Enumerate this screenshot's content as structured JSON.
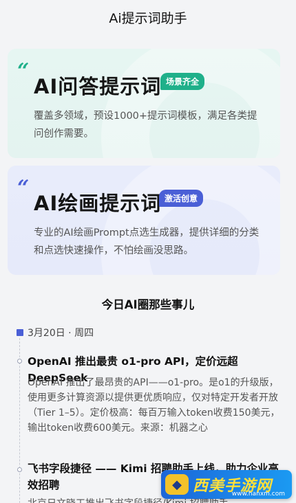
{
  "header": {
    "title": "Ai提示词助手"
  },
  "cards": {
    "qa": {
      "title": "AI问答提示词",
      "badge": "场景齐全",
      "description": "覆盖多领域，预设1000+提示词模板，满足各类提问创作需要。"
    },
    "draw": {
      "title": "AI绘画提示词",
      "badge": "激活创意",
      "description": "专业的AI绘画Prompt点选生成器，提供详细的分类和点选快速操作，不怕绘画没思路。"
    }
  },
  "news": {
    "section_title": "今日AI圈那些事儿",
    "date": "3月20日 · 周四",
    "items": [
      {
        "title": "OpenAI 推出最贵 o1-pro API，定价远超 DeepSeek",
        "body": "OpenAI 推出了最昂贵的API——o1-pro。是o1的升级版，使用更多计算资源以提供更优质响应，仅对特定开发者开放（Tier 1–5）。定价极高：每百万输入token收费150美元，输出token收费600美元。来源：机器之心"
      },
      {
        "title": "飞书字段捷径 —— Kimi 招聘助手上线，助力企业高效招聘",
        "body": "北京日文晓工推出飞书字段捷径/Kimi 招聘助手..."
      }
    ]
  },
  "colors": {
    "qa_accent": "#1fb08a",
    "draw_accent": "#4a5fd6"
  }
}
